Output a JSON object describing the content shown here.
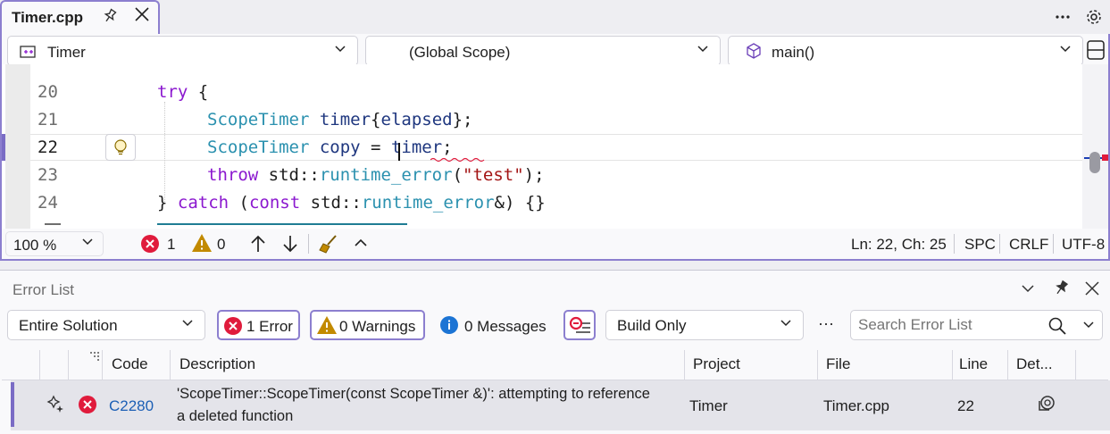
{
  "editor": {
    "tab": {
      "title": "Timer.cpp"
    },
    "navbar": {
      "project": "Timer",
      "scope": "(Global Scope)",
      "member": "main()"
    },
    "lines": [
      {
        "num": "20",
        "tokens": [
          {
            "t": "try",
            "c": "kw"
          },
          {
            "t": " {",
            "c": ""
          }
        ]
      },
      {
        "num": "21",
        "tokens": [
          {
            "t": "ScopeTimer",
            "c": "ty"
          },
          {
            "t": " ",
            "c": ""
          },
          {
            "t": "timer",
            "c": "var"
          },
          {
            "t": "{",
            "c": ""
          },
          {
            "t": "elapsed",
            "c": "var"
          },
          {
            "t": "};",
            "c": ""
          }
        ]
      },
      {
        "num": "22",
        "tokens": [
          {
            "t": "ScopeTimer",
            "c": "ty"
          },
          {
            "t": " ",
            "c": ""
          },
          {
            "t": "copy",
            "c": "var"
          },
          {
            "t": " = ",
            "c": ""
          },
          {
            "t": "timer",
            "c": "var"
          },
          {
            "t": ";",
            "c": ""
          }
        ]
      },
      {
        "num": "23",
        "tokens": [
          {
            "t": "throw",
            "c": "kw"
          },
          {
            "t": " std::",
            "c": ""
          },
          {
            "t": "runtime_error",
            "c": "ty"
          },
          {
            "t": "(",
            "c": ""
          },
          {
            "t": "\"test\"",
            "c": "str"
          },
          {
            "t": ");",
            "c": ""
          }
        ]
      },
      {
        "num": "24",
        "tokens": [
          {
            "t": "} ",
            "c": ""
          },
          {
            "t": "catch",
            "c": "kw"
          },
          {
            "t": " (",
            "c": ""
          },
          {
            "t": "const",
            "c": "kw"
          },
          {
            "t": " std::",
            "c": ""
          },
          {
            "t": "runtime_error",
            "c": "ty"
          },
          {
            "t": "&) {}",
            "c": ""
          }
        ]
      }
    ],
    "status": {
      "zoom": "100 %",
      "errors": "1",
      "warnings": "0",
      "position": "Ln: 22, Ch: 25",
      "whitespace": "SPC",
      "line_ending": "CRLF",
      "encoding": "UTF-8"
    }
  },
  "error_list": {
    "title": "Error List",
    "scope": "Entire Solution",
    "errors_label": "1 Error",
    "warnings_label": "0 Warnings",
    "messages_label": "0 Messages",
    "build_filter": "Build Only",
    "more_label": "···",
    "search_placeholder": "Search Error List",
    "columns": {
      "code": "Code",
      "description": "Description",
      "project": "Project",
      "file": "File",
      "line": "Line",
      "details": "Det..."
    },
    "rows": [
      {
        "code": "C2280",
        "description_1": "'ScopeTimer::ScopeTimer(const ScopeTimer &)': attempting to reference",
        "description_2": "a deleted function",
        "project": "Timer",
        "file": "Timer.cpp",
        "line": "22"
      }
    ]
  },
  "colors": {
    "accent": "#8c7fcf",
    "error": "#e01b3c",
    "warning": "#c28a00",
    "info": "#1c74d4",
    "link": "#1c5fb5"
  }
}
